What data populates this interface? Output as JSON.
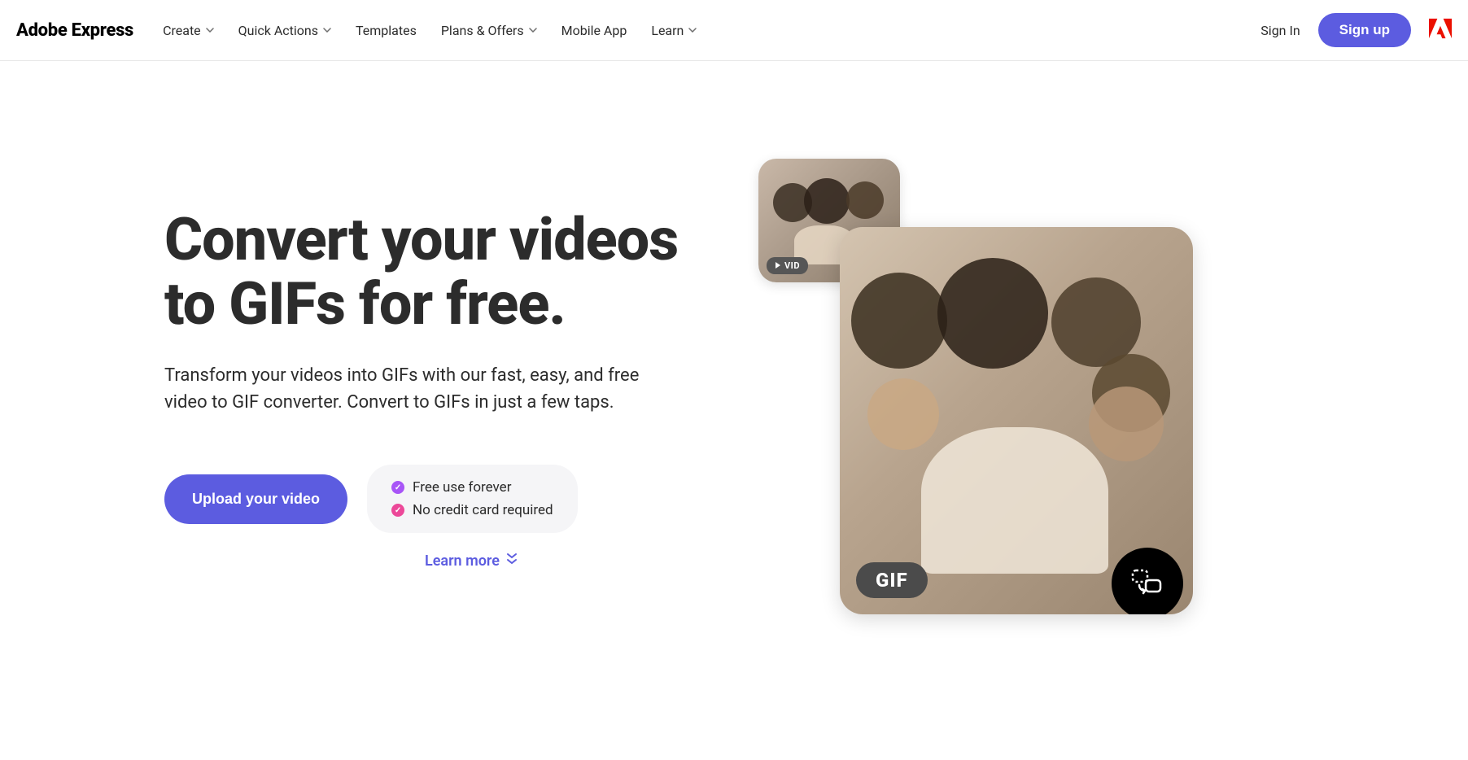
{
  "header": {
    "logo": "Adobe Express",
    "nav": [
      {
        "label": "Create",
        "has_dropdown": true
      },
      {
        "label": "Quick Actions",
        "has_dropdown": true
      },
      {
        "label": "Templates",
        "has_dropdown": false
      },
      {
        "label": "Plans & Offers",
        "has_dropdown": true
      },
      {
        "label": "Mobile App",
        "has_dropdown": false
      },
      {
        "label": "Learn",
        "has_dropdown": true
      }
    ],
    "sign_in": "Sign In",
    "sign_up": "Sign up"
  },
  "hero": {
    "title": "Convert your videos to GIFs for free.",
    "subtitle": "Transform your videos into GIFs with our fast, easy, and free video to GIF converter. Convert to GIFs in just a few taps.",
    "upload_label": "Upload your video",
    "benefits": [
      "Free use forever",
      "No credit card required"
    ],
    "learn_more": "Learn more",
    "vid_badge": "VID",
    "gif_badge": "GIF"
  },
  "colors": {
    "accent": "#5c5ce0",
    "check_purple": "#a855f7",
    "check_pink": "#ec4899"
  }
}
